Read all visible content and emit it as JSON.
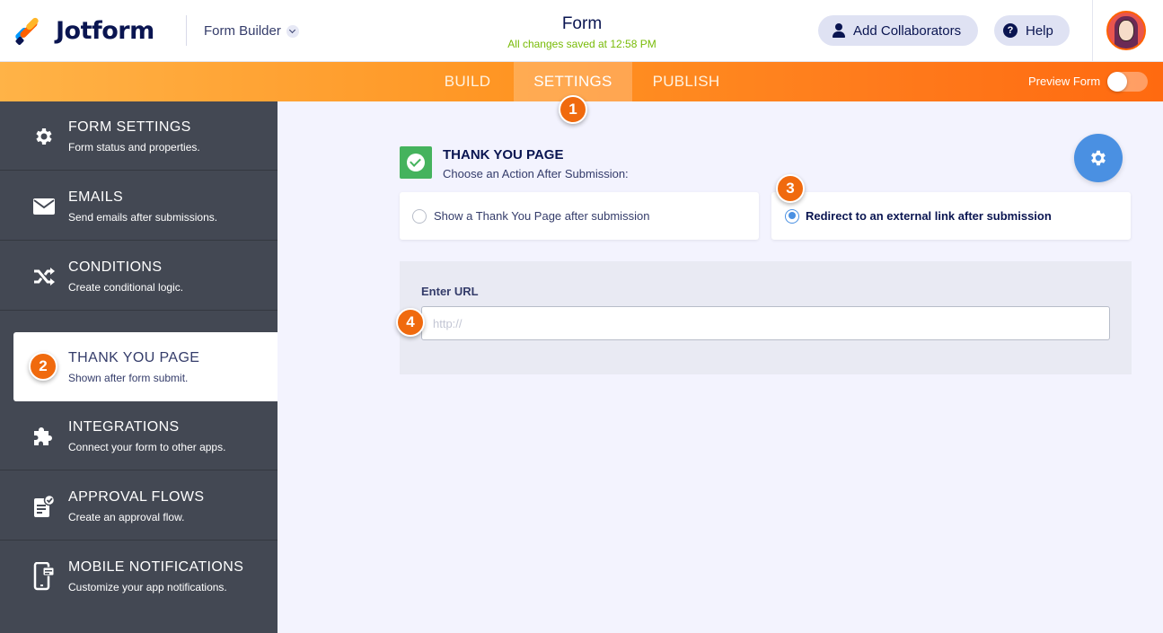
{
  "header": {
    "brand": "Jotform",
    "builder_label": "Form Builder",
    "form_title": "Form",
    "save_status": "All changes saved at 12:58 PM",
    "collaborators_label": "Add Collaborators",
    "help_label": "Help"
  },
  "nav": {
    "tabs": [
      {
        "label": "BUILD"
      },
      {
        "label": "SETTINGS",
        "active": true
      },
      {
        "label": "PUBLISH"
      }
    ],
    "preview_label": "Preview Form",
    "preview_on": false
  },
  "sidebar": {
    "items": [
      {
        "title": "FORM SETTINGS",
        "subtitle": "Form status and properties.",
        "icon": "gear-icon"
      },
      {
        "title": "EMAILS",
        "subtitle": "Send emails after submissions.",
        "icon": "envelope-icon"
      },
      {
        "title": "CONDITIONS",
        "subtitle": "Create conditional logic.",
        "icon": "shuffle-icon"
      },
      {
        "title": "THANK YOU PAGE",
        "subtitle": "Shown after form submit.",
        "icon": "thank-you-icon",
        "active": true
      },
      {
        "title": "INTEGRATIONS",
        "subtitle": "Connect your form to other apps.",
        "icon": "puzzle-icon"
      },
      {
        "title": "APPROVAL FLOWS",
        "subtitle": "Create an approval flow.",
        "icon": "approval-icon"
      },
      {
        "title": "MOBILE NOTIFICATIONS",
        "subtitle": "Customize your app notifications.",
        "icon": "mobile-icon"
      }
    ]
  },
  "main": {
    "section_title": "THANK YOU PAGE",
    "section_subtitle": "Choose an Action After Submission:",
    "options": [
      {
        "label": "Show a Thank You Page after submission",
        "selected": false
      },
      {
        "label": "Redirect to an external link after submission",
        "selected": true
      }
    ],
    "url_label": "Enter URL",
    "url_placeholder": "http://",
    "url_value": ""
  },
  "step_badges": [
    "1",
    "2",
    "3",
    "4"
  ],
  "colors": {
    "accent_orange": "#ff7b1c",
    "sidebar_bg": "#434853",
    "success_green": "#45b35d",
    "primary_blue": "#4a90e2",
    "badge_orange": "#f06a0e"
  }
}
